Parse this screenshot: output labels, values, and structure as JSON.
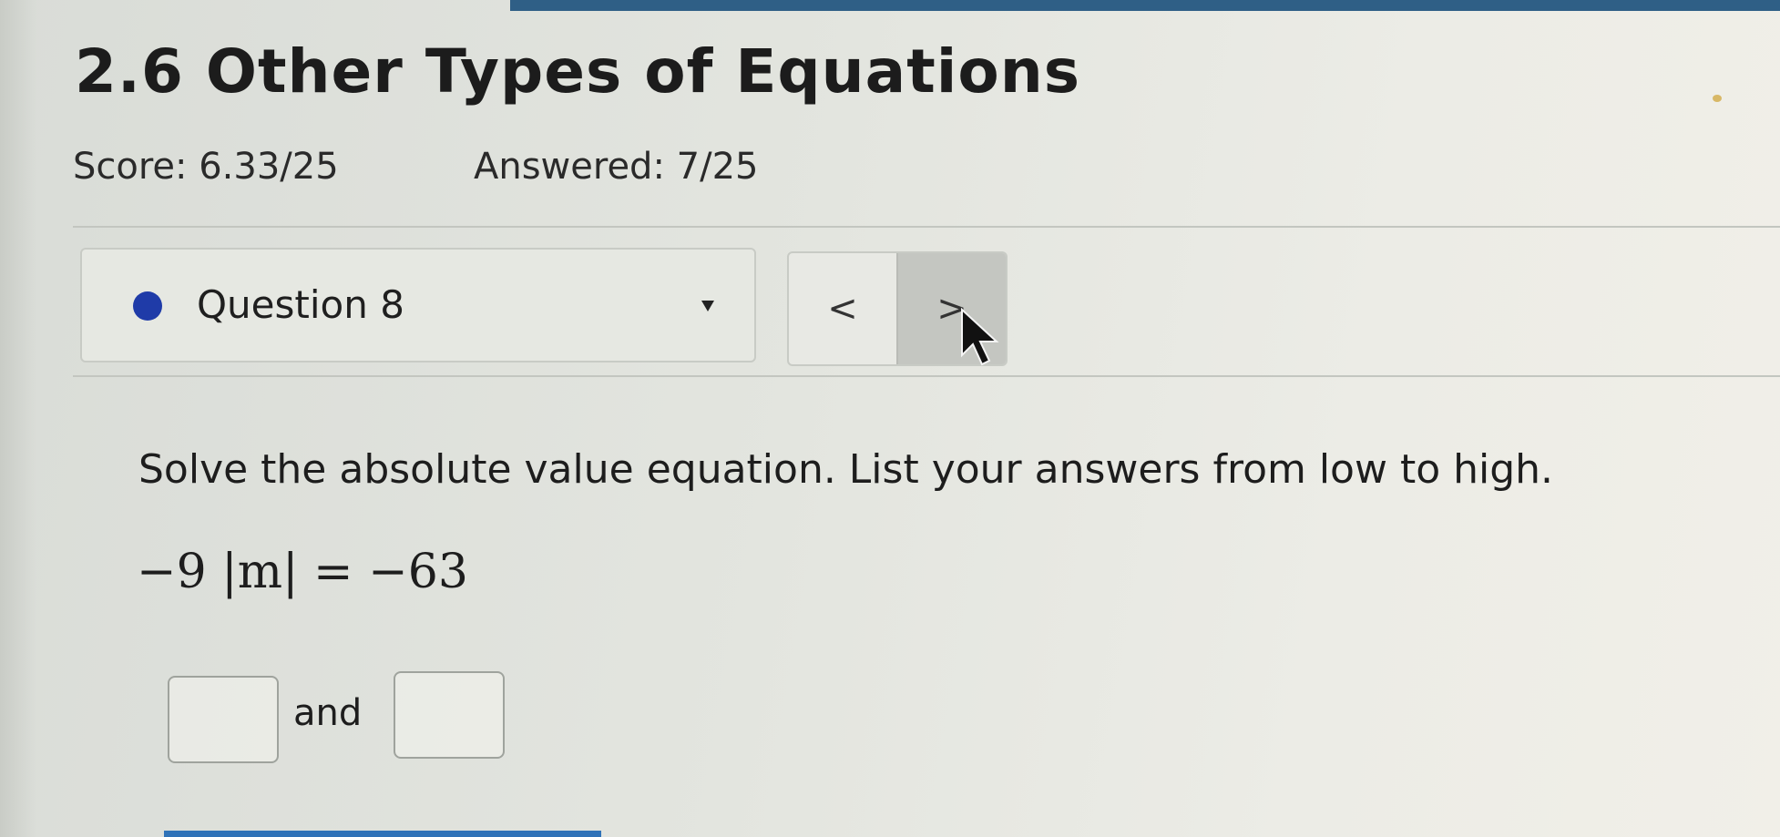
{
  "page": {
    "title": "2.6 Other Types of Equations"
  },
  "progress": {
    "score": "Score: 6.33/25",
    "answered": "Answered: 7/25"
  },
  "question_nav": {
    "selected_label": "Question 8",
    "status_dot_color": "#1f3ba8",
    "prev_symbol": "<",
    "next_symbol": ">"
  },
  "question": {
    "prompt": "Solve the absolute value equation. List your answers from low to high.",
    "equation": "−9 |m| = −63",
    "connector": "and",
    "answer_1": "",
    "answer_2": ""
  },
  "colors": {
    "top_strip": "#2f5f86",
    "bottom_bar": "#2f72b8"
  }
}
